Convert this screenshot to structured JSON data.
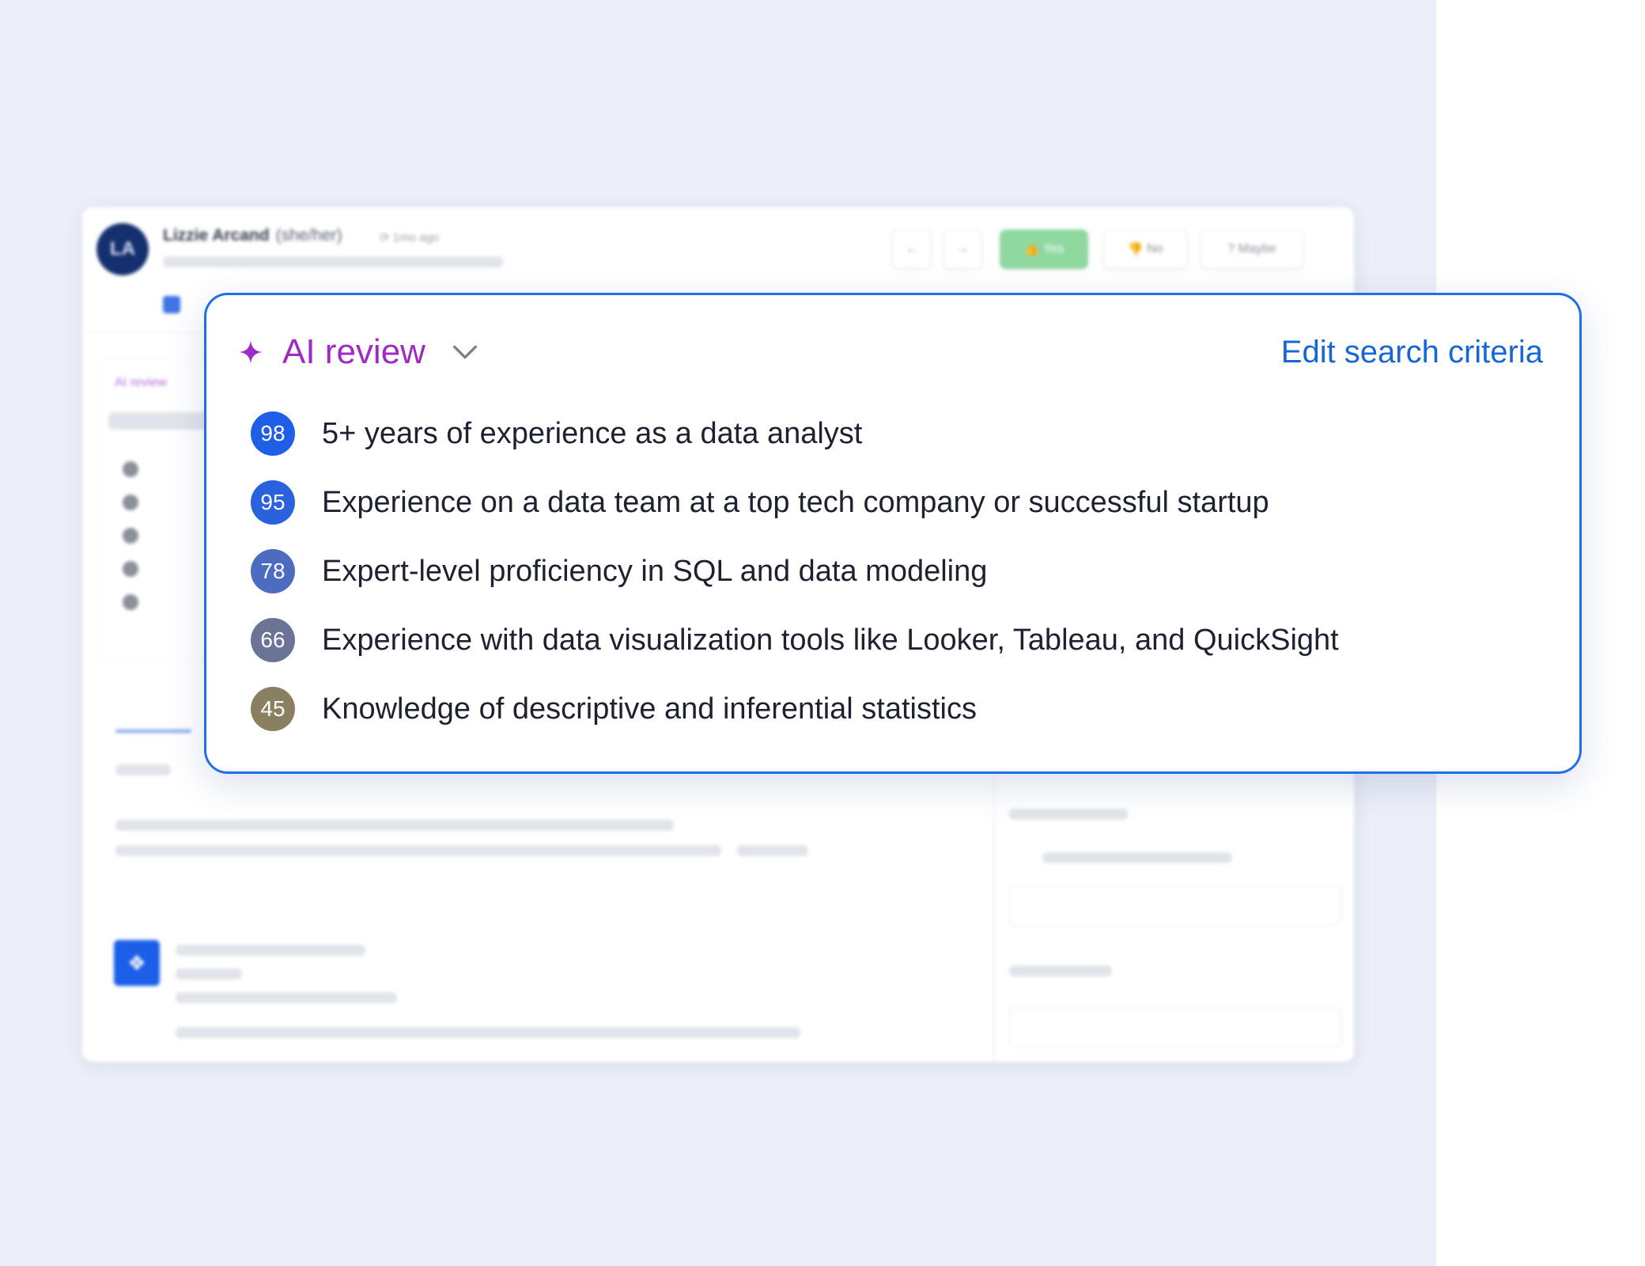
{
  "background_app": {
    "candidate": {
      "initials": "LA",
      "name": "Lizzie Arcand",
      "pronouns": "(she/her)",
      "updated": "1mo ago"
    },
    "actions": {
      "yes_label": "Yes",
      "no_label": "No",
      "maybe_label": "Maybe"
    },
    "ai_review_label": "AI review"
  },
  "ai_review": {
    "title": "AI review",
    "edit_link": "Edit search criteria",
    "criteria": [
      {
        "score": "98",
        "label": "5+ years of experience as a data analyst",
        "color": "#1f5fe8"
      },
      {
        "score": "95",
        "label": "Experience on a data team at a top tech company or successful startup",
        "color": "#2a62dd"
      },
      {
        "score": "78",
        "label": "Expert-level proficiency in SQL and data modeling",
        "color": "#4b6cc1"
      },
      {
        "score": "66",
        "label": "Experience with data visualization tools like Looker, Tableau, and QuickSight",
        "color": "#6a7595"
      },
      {
        "score": "45",
        "label": "Knowledge of descriptive and inferential statistics",
        "color": "#8b7f62"
      }
    ]
  },
  "colors": {
    "accent_purple": "#a02bc4",
    "link_blue": "#1766d8",
    "card_border": "#1f6fe6",
    "page_bg": "#eceff8"
  }
}
